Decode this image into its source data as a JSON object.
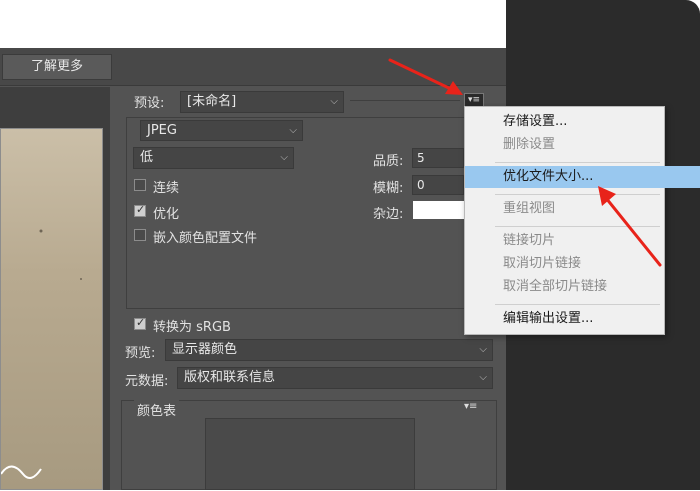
{
  "toolbar": {
    "learn_more": "了解更多"
  },
  "settings": {
    "preset_label": "预设:",
    "preset_value": "[未命名]",
    "format_value": "JPEG",
    "quality_preset": "低",
    "quality_label": "品质:",
    "quality_value": "5",
    "blur_label": "模糊:",
    "blur_value": "0",
    "matte_label": "杂边:",
    "progressive_label": "连续",
    "progressive_checked": false,
    "optimized_label": "优化",
    "optimized_checked": true,
    "embed_profile_label": "嵌入颜色配置文件",
    "embed_profile_checked": false,
    "convert_srgb_label": "转换为 sRGB",
    "convert_srgb_checked": true,
    "preview_label": "预览:",
    "preview_value": "显示器颜色",
    "metadata_label": "元数据:",
    "metadata_value": "版权和联系信息",
    "color_table_label": "颜色表"
  },
  "menu": {
    "items": [
      {
        "label": "存储设置...",
        "disabled": false
      },
      {
        "label": "删除设置",
        "disabled": true
      },
      {
        "label": "优化文件大小...",
        "disabled": false,
        "highlighted": true
      },
      {
        "label": "重组视图",
        "disabled": true
      },
      {
        "label": "链接切片",
        "disabled": true
      },
      {
        "label": "取消切片链接",
        "disabled": true
      },
      {
        "label": "取消全部切片链接",
        "disabled": true
      },
      {
        "label": "编辑输出设置...",
        "disabled": false
      }
    ]
  },
  "colors": {
    "highlight": "#99c8ef",
    "arrow": "#e8231a",
    "panel": "#535353"
  },
  "icons": {
    "panel_menu": "panel-menu-icon",
    "dropdown": "chevron-down-icon",
    "check": "check-icon"
  }
}
